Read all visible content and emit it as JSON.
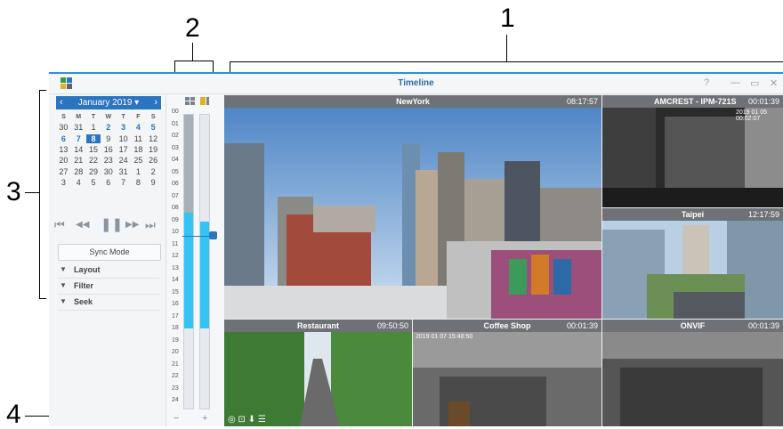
{
  "callouts": {
    "c1": "1",
    "c2": "2",
    "c3": "3",
    "c4": "4"
  },
  "window": {
    "title": "Timeline",
    "help": "?",
    "minimize": "—",
    "maximize": "▭",
    "close": "✕"
  },
  "calendar": {
    "month_label": "January 2019 ▾",
    "prev": "‹",
    "next": "›",
    "weekdays": [
      "S",
      "M",
      "T",
      "W",
      "T",
      "F",
      "S"
    ],
    "weeks": [
      [
        "30",
        "31",
        "1",
        "2",
        "3",
        "4",
        "5"
      ],
      [
        "6",
        "7",
        "8",
        "9",
        "10",
        "11",
        "12"
      ],
      [
        "13",
        "14",
        "15",
        "16",
        "17",
        "18",
        "19"
      ],
      [
        "20",
        "21",
        "22",
        "23",
        "24",
        "25",
        "26"
      ],
      [
        "27",
        "28",
        "29",
        "30",
        "31",
        "1",
        "2"
      ],
      [
        "3",
        "4",
        "5",
        "6",
        "7",
        "8",
        "9"
      ]
    ],
    "selected_day": "8",
    "days_with_recordings": [
      "2",
      "3",
      "4",
      "5",
      "6",
      "7"
    ]
  },
  "playback": {
    "first": "⏮",
    "rewind": "◀◀",
    "pause": "❚❚",
    "forward": "▶▶",
    "last": "⏭"
  },
  "sync_mode_label": "Sync Mode",
  "sections": {
    "layout": "Layout",
    "filter": "Filter",
    "seek": "Seek"
  },
  "timeline": {
    "hours": [
      "00",
      "01",
      "02",
      "03",
      "04",
      "05",
      "06",
      "07",
      "08",
      "09",
      "10",
      "11",
      "12",
      "13",
      "14",
      "15",
      "16",
      "17",
      "18",
      "19",
      "20",
      "21",
      "22",
      "23",
      "24"
    ],
    "recorded_until_hour": 17,
    "current_hour": 10,
    "zoom_out": "−",
    "zoom_in": "+"
  },
  "cameras": [
    {
      "name": "NewYork",
      "time": "08:17:57"
    },
    {
      "name": "AMCREST - IPM-721S",
      "time": "00:01:39",
      "stamp": "2019 01 05 00:02:07"
    },
    {
      "name": "Taipei",
      "time": "12:17:59"
    },
    {
      "name": "Restaurant",
      "time": "09:50:50"
    },
    {
      "name": "Coffee Shop",
      "time": "00:01:39",
      "stamp": "2019 01 07 15:48:50"
    },
    {
      "name": "ONVIF",
      "time": "00:01:39"
    }
  ],
  "colors": {
    "accent": "#2b74c0",
    "selected_border": "#e0b22b",
    "title_bar": "#2e8fd8",
    "recording_fill": "#35c3f3"
  }
}
